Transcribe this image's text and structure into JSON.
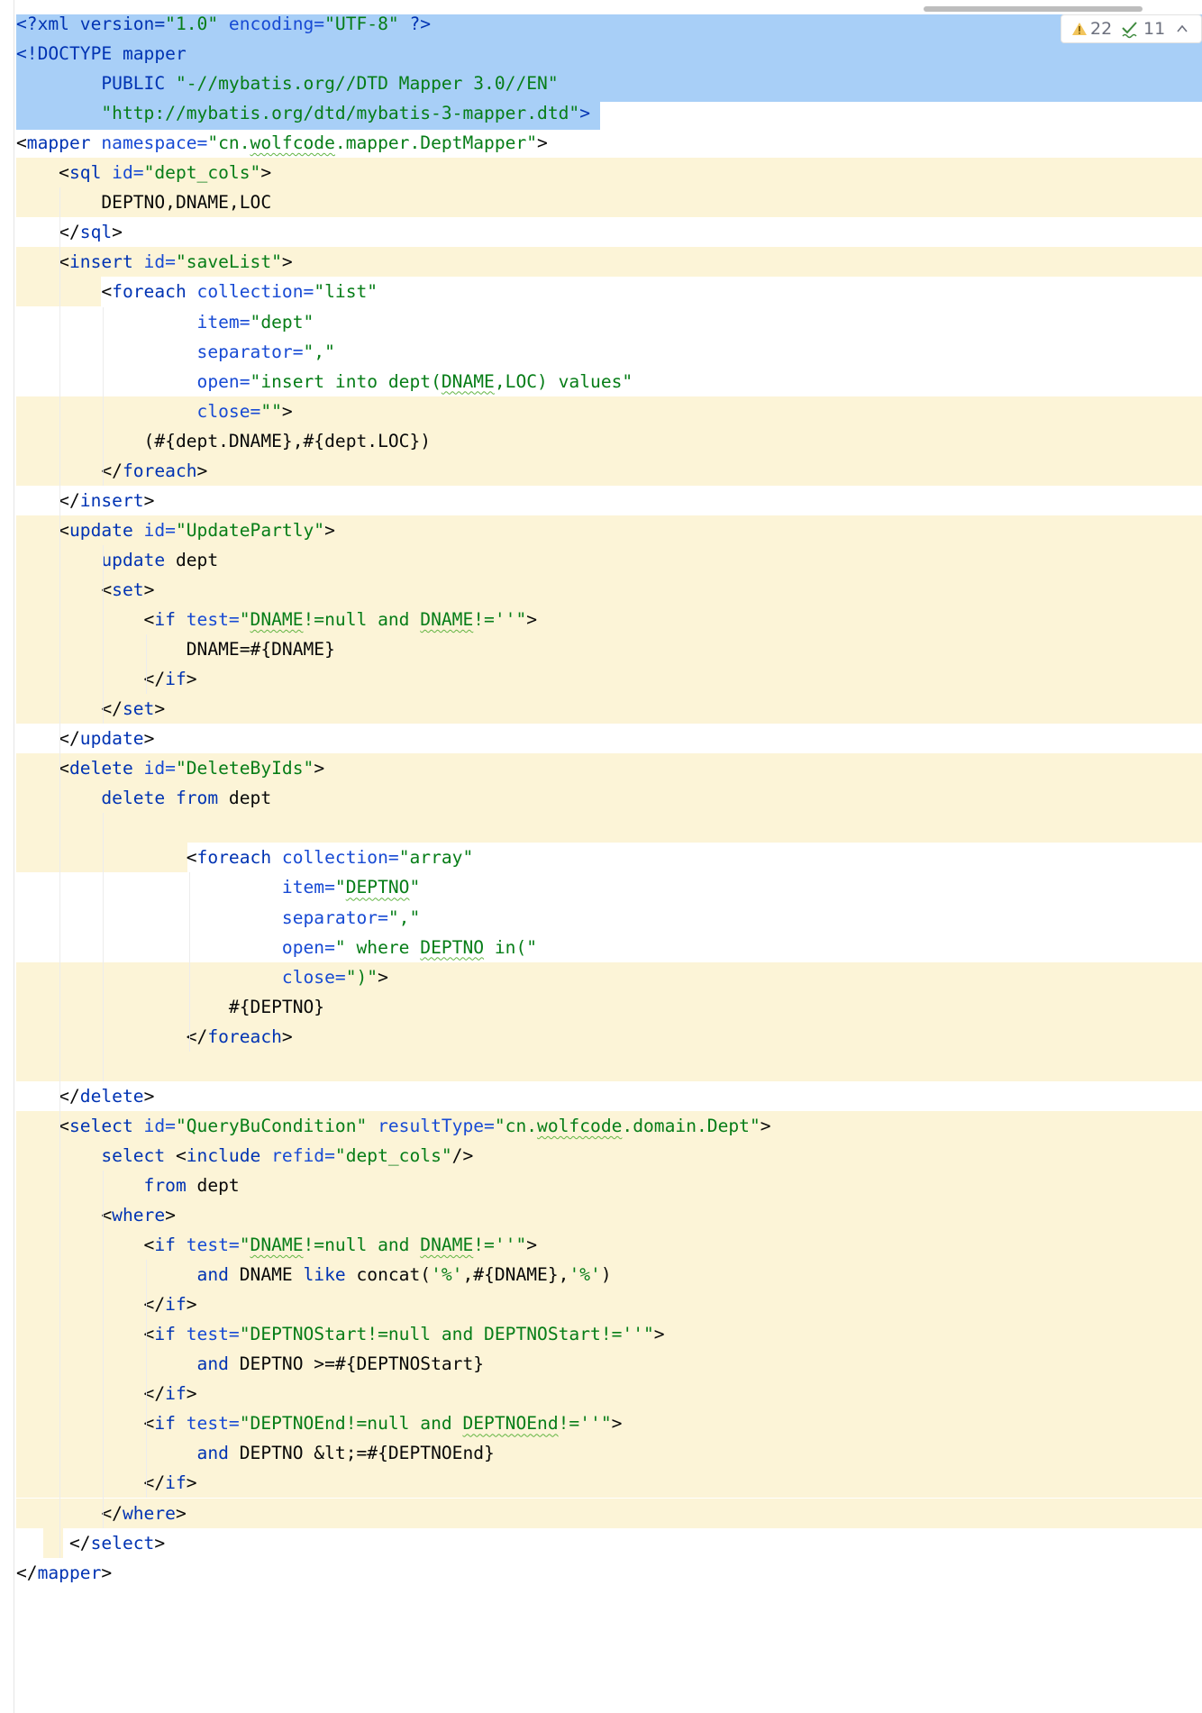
{
  "inspection": {
    "warnings": "22",
    "typos": "11"
  },
  "code_lines": [
    [
      [
        "tag",
        "<?xml version="
      ],
      [
        "str",
        "\"1.0\""
      ],
      [
        "attr",
        " encoding="
      ],
      [
        "str",
        "\"UTF-8\""
      ],
      [
        "tag",
        " ?>"
      ]
    ],
    [
      [
        "tag",
        "<!DOCTYPE mapper"
      ]
    ],
    [
      [
        "tag",
        "        PUBLIC "
      ],
      [
        "str",
        "\"-//mybatis.org//DTD Mapper 3.0//EN\""
      ]
    ],
    [
      [
        "str",
        "        \"http://mybatis.org/dtd/mybatis-3-mapper.dtd\""
      ],
      [
        "tag",
        ">"
      ]
    ],
    [
      [
        "plain",
        "<"
      ],
      [
        "tag",
        "mapper"
      ],
      [
        "attr",
        " namespace="
      ],
      [
        "str",
        "\"cn."
      ],
      [
        "str|wavy",
        "wolfcode"
      ],
      [
        "str",
        ".mapper.DeptMapper\""
      ],
      [
        "plain",
        ">"
      ]
    ],
    [
      [
        "plain",
        "    <"
      ],
      [
        "tag",
        "sql"
      ],
      [
        "attr",
        " id="
      ],
      [
        "str",
        "\"dept_cols\""
      ],
      [
        "plain",
        ">"
      ]
    ],
    [
      [
        "plain",
        "        DEPTNO,DNAME,LOC"
      ]
    ],
    [
      [
        "plain",
        "    </"
      ],
      [
        "tag",
        "sql"
      ],
      [
        "plain",
        ">"
      ]
    ],
    [
      [
        "plain",
        "    <"
      ],
      [
        "tag",
        "insert"
      ],
      [
        "attr",
        " id="
      ],
      [
        "str",
        "\"saveList\""
      ],
      [
        "plain",
        ">"
      ]
    ],
    [
      [
        "plain",
        "        <"
      ],
      [
        "tag",
        "foreach"
      ],
      [
        "attr",
        " collection="
      ],
      [
        "str",
        "\"list\""
      ]
    ],
    [
      [
        "attr",
        "                 item="
      ],
      [
        "str",
        "\"dept\""
      ]
    ],
    [
      [
        "attr",
        "                 separator="
      ],
      [
        "str",
        "\",\""
      ]
    ],
    [
      [
        "attr",
        "                 open="
      ],
      [
        "str",
        "\"insert into dept("
      ],
      [
        "str|wavy",
        "DNAME"
      ],
      [
        "str",
        ",LOC) values\""
      ]
    ],
    [
      [
        "attr",
        "                 close="
      ],
      [
        "str",
        "\"\""
      ],
      [
        "plain",
        ">"
      ]
    ],
    [
      [
        "plain",
        "            (#{dept.DNAME},#{dept.LOC})"
      ]
    ],
    [
      [
        "plain",
        "        </"
      ],
      [
        "tag",
        "foreach"
      ],
      [
        "plain",
        ">"
      ]
    ],
    [
      [
        "plain",
        "    </"
      ],
      [
        "tag",
        "insert"
      ],
      [
        "plain",
        ">"
      ]
    ],
    [
      [
        "plain",
        "    <"
      ],
      [
        "tag",
        "update"
      ],
      [
        "attr",
        " id="
      ],
      [
        "str",
        "\"UpdatePartly\""
      ],
      [
        "plain",
        ">"
      ]
    ],
    [
      [
        "kw",
        "        update"
      ],
      [
        "plain",
        " dept"
      ]
    ],
    [
      [
        "plain",
        "        <"
      ],
      [
        "tag",
        "set"
      ],
      [
        "plain",
        ">"
      ]
    ],
    [
      [
        "plain",
        "            <"
      ],
      [
        "tag",
        "if"
      ],
      [
        "attr",
        " test="
      ],
      [
        "str",
        "\""
      ],
      [
        "str|wavy",
        "DNAME"
      ],
      [
        "str",
        "!=null and "
      ],
      [
        "str|wavy",
        "DNAME"
      ],
      [
        "str",
        "!=''\""
      ],
      [
        "plain",
        ">"
      ]
    ],
    [
      [
        "plain",
        "                DNAME=#{DNAME}"
      ]
    ],
    [
      [
        "plain",
        "            </"
      ],
      [
        "tag",
        "if"
      ],
      [
        "plain",
        ">"
      ]
    ],
    [
      [
        "plain",
        "        </"
      ],
      [
        "tag",
        "set"
      ],
      [
        "plain",
        ">"
      ]
    ],
    [
      [
        "plain",
        "    </"
      ],
      [
        "tag",
        "update"
      ],
      [
        "plain",
        ">"
      ]
    ],
    [
      [
        "plain",
        "    <"
      ],
      [
        "tag",
        "delete"
      ],
      [
        "attr",
        " id="
      ],
      [
        "str",
        "\"DeleteByIds\""
      ],
      [
        "plain",
        ">"
      ]
    ],
    [
      [
        "kw",
        "        delete from"
      ],
      [
        "plain",
        " dept"
      ]
    ],
    [],
    [
      [
        "plain",
        "                <"
      ],
      [
        "tag",
        "foreach"
      ],
      [
        "attr",
        " collection="
      ],
      [
        "str",
        "\"array\""
      ]
    ],
    [
      [
        "attr",
        "                         item="
      ],
      [
        "str",
        "\""
      ],
      [
        "str|wavy",
        "DEPTNO"
      ],
      [
        "str",
        "\""
      ]
    ],
    [
      [
        "attr",
        "                         separator="
      ],
      [
        "str",
        "\",\""
      ]
    ],
    [
      [
        "attr",
        "                         open="
      ],
      [
        "str",
        "\" where "
      ],
      [
        "str|wavy",
        "DEPTNO"
      ],
      [
        "str",
        " in(\""
      ]
    ],
    [
      [
        "attr",
        "                         close="
      ],
      [
        "str",
        "\")\""
      ],
      [
        "plain",
        ">"
      ]
    ],
    [
      [
        "plain",
        "                    #{DEPTNO}"
      ]
    ],
    [
      [
        "plain",
        "                </"
      ],
      [
        "tag",
        "foreach"
      ],
      [
        "plain",
        ">"
      ]
    ],
    [],
    [
      [
        "plain",
        "    </"
      ],
      [
        "tag",
        "delete"
      ],
      [
        "plain",
        ">"
      ]
    ],
    [
      [
        "plain",
        "    <"
      ],
      [
        "tag",
        "select"
      ],
      [
        "attr",
        " id="
      ],
      [
        "str",
        "\"QueryBuCondition\""
      ],
      [
        "attr",
        " resultType="
      ],
      [
        "str",
        "\"cn."
      ],
      [
        "str|wavy",
        "wolfcode"
      ],
      [
        "str",
        ".domain.Dept\""
      ],
      [
        "plain",
        ">"
      ]
    ],
    [
      [
        "kw",
        "        select"
      ],
      [
        "plain",
        " <"
      ],
      [
        "tag",
        "include"
      ],
      [
        "attr",
        " refid="
      ],
      [
        "str",
        "\"dept_cols\""
      ],
      [
        "plain",
        "/>"
      ]
    ],
    [
      [
        "kw",
        "            from"
      ],
      [
        "plain",
        " dept"
      ]
    ],
    [
      [
        "plain",
        "        <"
      ],
      [
        "tag",
        "where"
      ],
      [
        "plain",
        ">"
      ]
    ],
    [
      [
        "plain",
        "            <"
      ],
      [
        "tag",
        "if"
      ],
      [
        "attr",
        " test="
      ],
      [
        "str",
        "\""
      ],
      [
        "str|wavy",
        "DNAME"
      ],
      [
        "str",
        "!=null and "
      ],
      [
        "str|wavy",
        "DNAME"
      ],
      [
        "str",
        "!=''\""
      ],
      [
        "plain",
        ">"
      ]
    ],
    [
      [
        "kw",
        "                 and"
      ],
      [
        "plain",
        " DNAME "
      ],
      [
        "kw",
        "like"
      ],
      [
        "plain",
        " concat("
      ],
      [
        "str",
        "'%'"
      ],
      [
        "plain",
        ",#{DNAME},"
      ],
      [
        "str",
        "'%'"
      ],
      [
        "plain",
        ")"
      ]
    ],
    [
      [
        "plain",
        "            </"
      ],
      [
        "tag",
        "if"
      ],
      [
        "plain",
        ">"
      ]
    ],
    [
      [
        "plain",
        "            <"
      ],
      [
        "tag",
        "if"
      ],
      [
        "attr",
        " test="
      ],
      [
        "str",
        "\"DEPTNOStart!=null and DEPTNOStart!=''\""
      ],
      [
        "plain",
        ">"
      ]
    ],
    [
      [
        "kw",
        "                 and"
      ],
      [
        "plain",
        " DEPTNO >=#{DEPTNOStart}"
      ]
    ],
    [
      [
        "plain",
        "            </"
      ],
      [
        "tag",
        "if"
      ],
      [
        "plain",
        ">"
      ]
    ],
    [
      [
        "plain",
        "            <"
      ],
      [
        "tag",
        "if"
      ],
      [
        "attr",
        " test="
      ],
      [
        "str",
        "\"DEPTNOEnd!=null and "
      ],
      [
        "str|wavy",
        "DEPTNOEnd"
      ],
      [
        "str",
        "!=''\""
      ],
      [
        "plain",
        ">"
      ]
    ],
    [
      [
        "kw",
        "                 and"
      ],
      [
        "plain",
        " DEPTNO &lt;=#{DEPTNOEnd}"
      ]
    ],
    [
      [
        "plain",
        "            </"
      ],
      [
        "tag",
        "if"
      ],
      [
        "plain",
        ">"
      ]
    ],
    [
      [
        "plain",
        "        </"
      ],
      [
        "tag",
        "where"
      ],
      [
        "plain",
        ">"
      ]
    ],
    [
      [
        "plain",
        "     </"
      ],
      [
        "tag",
        "select"
      ],
      [
        "plain",
        ">"
      ]
    ],
    [
      [
        "plain",
        "</"
      ],
      [
        "tag",
        "mapper"
      ],
      [
        "plain",
        ">"
      ]
    ]
  ]
}
